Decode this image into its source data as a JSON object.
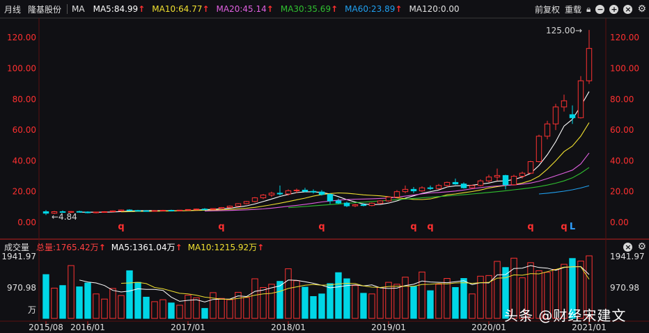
{
  "toolbar": {
    "period": "月线",
    "stock_name": "隆基股份",
    "ma_label": "MA",
    "ma5": "MA5:84.99",
    "ma10": "MA10:64.77",
    "ma20": "MA20:45.14",
    "ma30": "MA30:35.69",
    "ma60": "MA60:23.89",
    "ma120": "MA120:0.00",
    "up_arrow": "↑",
    "adjust": "前复权",
    "overlay": "重载"
  },
  "colors": {
    "up": "#ff3232",
    "down": "#00d6e6",
    "ma5": "#ffffff",
    "ma10": "#f0e030",
    "ma20": "#e060e0",
    "ma30": "#30c030",
    "ma60": "#20a0f0",
    "axis_text": "#ff3030"
  },
  "volume_bar": {
    "title": "成交量",
    "total": "总量:1765.42万",
    "ma5": "MA5:1361.04万",
    "ma10": "MA10:1215.92万",
    "up_arrow": "↑"
  },
  "price_annotations": {
    "high": "125.00→",
    "low": "←4.84"
  },
  "watermark": "头条 @财经宋建文",
  "chart_data": {
    "type": "candlestick",
    "price_ylim": [
      0,
      130
    ],
    "price_ticks": [
      "0.00",
      "20.00",
      "40.00",
      "60.00",
      "80.00",
      "100.00",
      "120.00"
    ],
    "volume_ticks": [
      "1941.97",
      "970.98"
    ],
    "volume_unit": "万",
    "x_ticks": [
      {
        "label": "2015/08",
        "index": 0
      },
      {
        "label": "2016/01",
        "index": 5
      },
      {
        "label": "2017/01",
        "index": 17
      },
      {
        "label": "2018/01",
        "index": 29
      },
      {
        "label": "2019/01",
        "index": 41
      },
      {
        "label": "2020/01",
        "index": 53
      },
      {
        "label": "2021/01",
        "index": 65
      }
    ],
    "markers": [
      {
        "index": 9,
        "text": "q"
      },
      {
        "index": 21,
        "text": "q"
      },
      {
        "index": 33,
        "text": "q"
      },
      {
        "index": 44,
        "text": "q"
      },
      {
        "index": 46,
        "text": "q"
      },
      {
        "index": 58,
        "text": "q"
      },
      {
        "index": 62,
        "text": "q"
      },
      {
        "index": 63,
        "text": "L"
      }
    ],
    "ohlc": [
      [
        7,
        8,
        4.84,
        6
      ],
      [
        6,
        7.5,
        5.5,
        7
      ],
      [
        7,
        7.8,
        6.3,
        6.6
      ],
      [
        6.6,
        7.4,
        6.2,
        7.1
      ],
      [
        7.1,
        7.6,
        6.6,
        6.8
      ],
      [
        6.8,
        7.2,
        6.0,
        6.3
      ],
      [
        6.3,
        7.0,
        5.9,
        6.8
      ],
      [
        6.8,
        7.3,
        6.4,
        7.0
      ],
      [
        7.0,
        7.8,
        6.7,
        7.5
      ],
      [
        7.5,
        8.4,
        7.2,
        8.1
      ],
      [
        8.1,
        8.6,
        7.6,
        7.8
      ],
      [
        7.8,
        8.2,
        7.3,
        7.6
      ],
      [
        7.6,
        8.0,
        7.1,
        7.3
      ],
      [
        7.3,
        7.9,
        7.0,
        7.7
      ],
      [
        7.7,
        8.2,
        7.4,
        7.9
      ],
      [
        7.9,
        8.3,
        7.5,
        7.7
      ],
      [
        7.7,
        8.1,
        7.3,
        8.0
      ],
      [
        8.0,
        8.6,
        7.7,
        8.4
      ],
      [
        8.4,
        9.0,
        8.0,
        8.7
      ],
      [
        8.7,
        9.3,
        8.3,
        8.5
      ],
      [
        8.5,
        9.2,
        8.1,
        9.0
      ],
      [
        9.0,
        10.0,
        8.7,
        9.7
      ],
      [
        9.7,
        11.0,
        9.4,
        10.6
      ],
      [
        10.6,
        12.5,
        10.2,
        12.2
      ],
      [
        12.2,
        14.0,
        11.8,
        13.6
      ],
      [
        13.6,
        16.5,
        13.0,
        16.0
      ],
      [
        16.0,
        18.5,
        15.2,
        17.8
      ],
      [
        17.8,
        20.0,
        16.6,
        19.0
      ],
      [
        19.0,
        24.0,
        17.5,
        18.5
      ],
      [
        18.5,
        21.5,
        17.5,
        20.6
      ],
      [
        20.6,
        22.0,
        19.0,
        21.0
      ],
      [
        21.0,
        22.5,
        19.6,
        20.2
      ],
      [
        20.2,
        21.5,
        18.8,
        19.8
      ],
      [
        19.8,
        21.0,
        17.5,
        18.2
      ],
      [
        18.2,
        19.0,
        12.0,
        14.0
      ],
      [
        14.0,
        15.5,
        12.0,
        12.6
      ],
      [
        12.6,
        13.5,
        10.0,
        10.8
      ],
      [
        10.8,
        12.0,
        10.0,
        11.5
      ],
      [
        11.5,
        12.5,
        10.5,
        11.0
      ],
      [
        11.0,
        13.0,
        10.5,
        12.5
      ],
      [
        12.5,
        14.5,
        12.0,
        14.0
      ],
      [
        14.0,
        17.0,
        13.5,
        16.5
      ],
      [
        16.5,
        21.0,
        16.0,
        20.0
      ],
      [
        20.0,
        24.0,
        19.0,
        21.5
      ],
      [
        21.5,
        23.0,
        19.0,
        20.5
      ],
      [
        20.5,
        23.5,
        20.0,
        22.5
      ],
      [
        22.5,
        24.0,
        21.0,
        22.0
      ],
      [
        22.0,
        25.0,
        21.5,
        24.0
      ],
      [
        24.0,
        26.5,
        23.0,
        26.0
      ],
      [
        26.0,
        28.5,
        24.5,
        25.0
      ],
      [
        25.0,
        26.0,
        22.0,
        22.5
      ],
      [
        22.5,
        24.5,
        22.0,
        24.0
      ],
      [
        24.0,
        28.0,
        23.5,
        27.0
      ],
      [
        27.0,
        31.0,
        26.0,
        29.5
      ],
      [
        29.5,
        35.0,
        27.0,
        30.5
      ],
      [
        30.5,
        31.0,
        21.5,
        24.5
      ],
      [
        24.5,
        31.0,
        24.0,
        30.0
      ],
      [
        30.0,
        33.0,
        28.5,
        32.0
      ],
      [
        32.0,
        40.0,
        31.5,
        39.5
      ],
      [
        39.5,
        57.0,
        39.0,
        56.0
      ],
      [
        56.0,
        66.0,
        54.0,
        64.0
      ],
      [
        64.0,
        77.0,
        60.0,
        75.0
      ],
      [
        75.0,
        83.0,
        72.0,
        79.0
      ],
      [
        70.0,
        76.0,
        64.0,
        68.0
      ],
      [
        68.0,
        95.0,
        67.5,
        92.0
      ],
      [
        92.0,
        125.0,
        90.0,
        113.0
      ]
    ],
    "volume": [
      1360,
      940,
      1020,
      1640,
      980,
      1100,
      760,
      600,
      930,
      710,
      1480,
      1120,
      660,
      520,
      580,
      480,
      410,
      720,
      640,
      310,
      800,
      620,
      580,
      810,
      650,
      1230,
      960,
      1060,
      1150,
      1540,
      1170,
      970,
      680,
      760,
      1080,
      1420,
      1230,
      1020,
      780,
      760,
      960,
      1120,
      1060,
      1280,
      990,
      1440,
      860,
      1060,
      1240,
      960,
      1240,
      760,
      1310,
      1330,
      1770,
      1580,
      1870,
      1260,
      1730,
      1480,
      1430,
      1520,
      1680,
      1860,
      1780,
      1941.97
    ],
    "ma_lines": {
      "ma5": [
        null,
        null,
        null,
        null,
        6.7,
        6.7,
        6.7,
        6.7,
        6.8,
        7.1,
        7.4,
        7.6,
        7.7,
        7.7,
        7.6,
        7.6,
        7.6,
        7.7,
        8.0,
        8.3,
        8.5,
        8.9,
        9.3,
        10.0,
        10.8,
        12.0,
        13.6,
        15.2,
        16.9,
        18.2,
        19.4,
        19.9,
        19.9,
        19.5,
        18.5,
        16.8,
        14.8,
        13.3,
        12.0,
        11.6,
        11.7,
        12.6,
        14.0,
        15.8,
        17.3,
        18.9,
        20.0,
        21.1,
        23.0,
        23.8,
        23.9,
        24.2,
        24.9,
        25.6,
        26.8,
        27.0,
        27.9,
        29.5,
        31.9,
        37.0,
        44.0,
        52.4,
        62.6,
        67.0,
        75.6,
        85.0
      ],
      "ma10": [
        null,
        null,
        null,
        null,
        null,
        null,
        null,
        null,
        null,
        6.9,
        7.0,
        7.2,
        7.2,
        7.3,
        7.4,
        7.4,
        7.6,
        7.7,
        7.8,
        7.9,
        8.1,
        8.2,
        8.5,
        8.8,
        9.2,
        9.8,
        10.6,
        11.5,
        12.5,
        13.6,
        14.7,
        15.8,
        17.1,
        18.1,
        18.8,
        19.2,
        19.0,
        18.5,
        17.9,
        17.6,
        17.3,
        16.7,
        16.0,
        15.5,
        15.0,
        14.9,
        15.3,
        16.5,
        17.9,
        18.5,
        19.3,
        20.1,
        21.1,
        22.4,
        23.3,
        24.0,
        24.6,
        25.6,
        27.2,
        30.0,
        34.6,
        40.0,
        46.0,
        49.6,
        56.0,
        64.8
      ],
      "ma20": [
        null,
        null,
        null,
        null,
        null,
        null,
        null,
        null,
        null,
        null,
        null,
        null,
        null,
        null,
        null,
        null,
        null,
        null,
        null,
        7.4,
        7.6,
        7.7,
        7.8,
        8.0,
        8.2,
        8.5,
        8.8,
        9.3,
        9.9,
        10.5,
        11.1,
        11.8,
        12.5,
        13.3,
        13.9,
        14.5,
        14.9,
        15.1,
        15.2,
        15.4,
        15.6,
        15.9,
        16.4,
        17.1,
        17.8,
        18.6,
        19.2,
        19.5,
        19.9,
        20.4,
        21.1,
        21.9,
        22.6,
        23.2,
        23.7,
        24.1,
        24.4,
        24.9,
        25.6,
        26.8,
        28.5,
        30.3,
        32.1,
        34.0,
        38.0,
        45.1
      ],
      "ma30": [
        null,
        null,
        null,
        null,
        null,
        null,
        null,
        null,
        null,
        null,
        null,
        null,
        null,
        null,
        null,
        null,
        null,
        null,
        null,
        null,
        null,
        null,
        null,
        null,
        null,
        null,
        null,
        null,
        null,
        9.6,
        10.0,
        10.4,
        10.8,
        11.2,
        11.6,
        12.0,
        12.4,
        12.8,
        13.2,
        13.6,
        14.0,
        14.4,
        14.8,
        15.2,
        15.6,
        16.0,
        16.4,
        16.8,
        17.2,
        17.6,
        18.0,
        18.5,
        19.0,
        19.5,
        20.0,
        20.6,
        21.2,
        21.8,
        22.5,
        23.3,
        24.3,
        25.5,
        27.0,
        29.0,
        32.0,
        35.7
      ],
      "ma60": [
        null,
        null,
        null,
        null,
        null,
        null,
        null,
        null,
        null,
        null,
        null,
        null,
        null,
        null,
        null,
        null,
        null,
        null,
        null,
        null,
        null,
        null,
        null,
        null,
        null,
        null,
        null,
        null,
        null,
        null,
        null,
        null,
        null,
        null,
        null,
        null,
        null,
        null,
        null,
        null,
        null,
        null,
        null,
        null,
        null,
        null,
        null,
        null,
        null,
        null,
        null,
        null,
        null,
        null,
        null,
        null,
        null,
        null,
        null,
        18.5,
        19.0,
        19.6,
        20.3,
        21.2,
        22.4,
        23.9
      ],
      "vol_ma5": [
        null,
        null,
        null,
        null,
        1190,
        1130,
        1100,
        1020,
        870,
        820,
        850,
        920,
        900,
        900,
        870,
        660,
        530,
        560,
        580,
        510,
        590,
        600,
        600,
        700,
        680,
        840,
        880,
        950,
        1010,
        1190,
        1180,
        1140,
        1090,
        1030,
        950,
        980,
        1020,
        1040,
        1010,
        1040,
        950,
        930,
        940,
        1020,
        1060,
        1160,
        1130,
        1120,
        1110,
        1140,
        1170,
        1050,
        1110,
        1100,
        1350,
        1360,
        1550,
        1560,
        1640,
        1580,
        1560,
        1490,
        1580,
        1600,
        1610,
        1361.04
      ],
      "vol_ma10": [
        null,
        null,
        null,
        null,
        null,
        null,
        null,
        null,
        null,
        1090,
        1100,
        1120,
        1080,
        960,
        920,
        850,
        780,
        760,
        720,
        660,
        630,
        600,
        590,
        620,
        660,
        720,
        760,
        780,
        840,
        930,
        980,
        1030,
        1050,
        1030,
        1040,
        1070,
        1090,
        1080,
        1010,
        970,
        960,
        990,
        1000,
        1000,
        1000,
        1050,
        1060,
        1080,
        1070,
        1100,
        1110,
        1090,
        1110,
        1120,
        1250,
        1260,
        1350,
        1340,
        1390,
        1380,
        1450,
        1520,
        1590,
        1600,
        1600,
        1215.92
      ]
    }
  }
}
